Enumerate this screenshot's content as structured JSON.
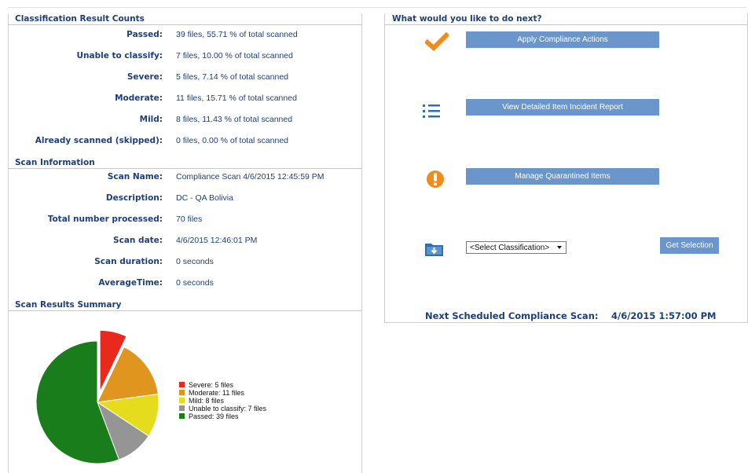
{
  "counts": {
    "title": "Classification Result Counts",
    "rows": [
      {
        "label": "Passed:",
        "value": "39 files, 55.71 % of total scanned"
      },
      {
        "label": "Unable to classify:",
        "value": "7 files, 10.00 % of total scanned"
      },
      {
        "label": "Severe:",
        "value": "5 files, 7.14 % of total scanned"
      },
      {
        "label": "Moderate:",
        "value": "11 files, 15.71 % of total scanned"
      },
      {
        "label": "Mild:",
        "value": "8 files, 11.43 % of total scanned"
      },
      {
        "label": "Already scanned (skipped):",
        "value": "0 files, 0.00 % of total scanned"
      }
    ]
  },
  "scan_info": {
    "title": "Scan Information",
    "rows": [
      {
        "label": "Scan Name:",
        "value": "Compliance Scan 4/6/2015 12:45:59 PM"
      },
      {
        "label": "Description:",
        "value": "DC - QA Bolivia"
      },
      {
        "label": "Total number processed:",
        "value": "70 files"
      },
      {
        "label": "Scan date:",
        "value": "4/6/2015 12:46:01 PM"
      },
      {
        "label": "Scan duration:",
        "value": "0 seconds"
      },
      {
        "label": "AverageTime:",
        "value": "0 seconds"
      }
    ]
  },
  "summary": {
    "title": "Scan Results Summary"
  },
  "chart_data": {
    "type": "pie",
    "slices": [
      {
        "name": "Severe",
        "value": 5,
        "label": "Severe: 5 files",
        "color": "#e8291c",
        "exploded": true
      },
      {
        "name": "Moderate",
        "value": 11,
        "label": "Moderate: 11 files",
        "color": "#e0951f",
        "exploded": false
      },
      {
        "name": "Mild",
        "value": 8,
        "label": "Mild: 8 files",
        "color": "#e6dc1e",
        "exploded": false
      },
      {
        "name": "Unable to classify",
        "value": 7,
        "label": "Unable to classify: 7 files",
        "color": "#959595",
        "exploded": false
      },
      {
        "name": "Passed",
        "value": 39,
        "label": "Passed: 39 files",
        "color": "#1a7d1c",
        "exploded": false
      }
    ]
  },
  "next": {
    "title": "What would you like to do next?",
    "actions": [
      {
        "label": "Apply Compliance Actions",
        "icon": "checkmark-icon"
      },
      {
        "label": "View Detailed Item Incident Report",
        "icon": "list-icon"
      },
      {
        "label": "Manage Quarantined Items",
        "icon": "exclamation-icon"
      }
    ],
    "select_value": "<Select Classification>",
    "get_selection": "Get Selection",
    "scheduled_label": "Next Scheduled Compliance Scan:",
    "scheduled_value": "4/6/2015 1:57:00 PM"
  },
  "colors": {
    "accent": "#1c3f7a",
    "button": "#6b96cc",
    "check": "#f08c1e",
    "folder": "#2a6fb5"
  }
}
